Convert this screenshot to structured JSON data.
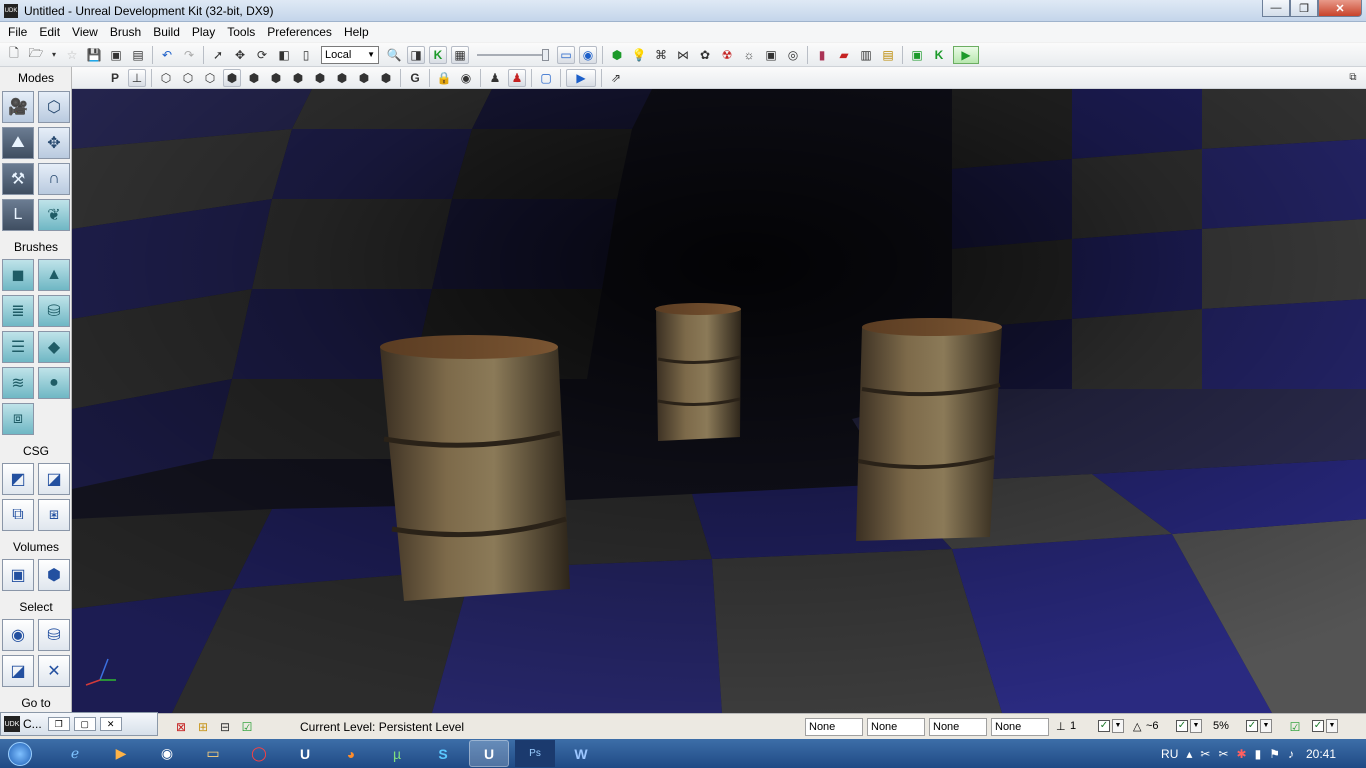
{
  "window": {
    "title": "Untitled - Unreal Development Kit (32-bit, DX9)",
    "app_icon": "UDK",
    "controls": [
      "—",
      "❐",
      "✕"
    ]
  },
  "menu": [
    "File",
    "Edit",
    "View",
    "Brush",
    "Build",
    "Play",
    "Tools",
    "Preferences",
    "Help"
  ],
  "toolbar": {
    "coord_system": "Local",
    "play_icon": "play-icon"
  },
  "toolbar2": {
    "p_label": "P",
    "g_label": "G"
  },
  "sidebar": {
    "modes_label": "Modes",
    "brushes_label": "Brushes",
    "csg_label": "CSG",
    "volumes_label": "Volumes",
    "select_label": "Select",
    "goto_label": "Go to"
  },
  "mini_window": {
    "icon": "UDK",
    "label": "C..."
  },
  "status": {
    "current_level": "Current Level:  Persistent Level",
    "fields": [
      "None",
      "None",
      "None",
      "None"
    ],
    "grid_value": "1",
    "rotation_value": "~6",
    "scale_value": "5%"
  },
  "taskbar": {
    "language": "RU",
    "time": "20:41"
  },
  "colors": {
    "accent": "#1c5fc9",
    "floor_blue": "#262676",
    "floor_grey": "#3c3c3c"
  }
}
